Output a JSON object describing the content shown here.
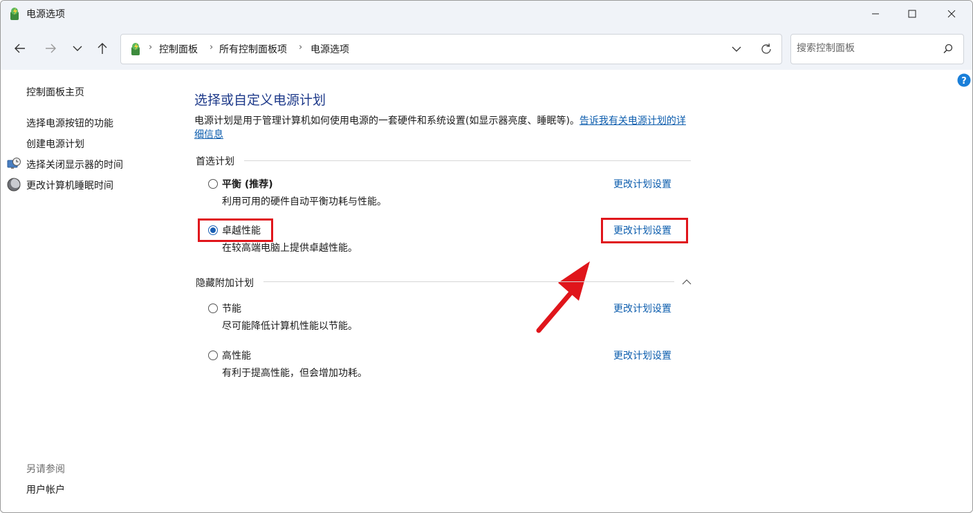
{
  "window": {
    "title": "电源选项"
  },
  "nav": {
    "breadcrumbs": [
      "控制面板",
      "所有控制面板项",
      "电源选项"
    ],
    "search_placeholder": "搜索控制面板"
  },
  "sidebar": {
    "home": "控制面板主页",
    "items": [
      {
        "label": "选择电源按钮的功能",
        "icon": ""
      },
      {
        "label": "创建电源计划",
        "icon": ""
      },
      {
        "label": "选择关闭显示器的时间",
        "icon": "monitor-clock-icon"
      },
      {
        "label": "更改计算机睡眠时间",
        "icon": "moon-icon"
      }
    ],
    "see_also_title": "另请参阅",
    "see_also_items": [
      "用户帐户"
    ]
  },
  "main": {
    "heading": "选择或自定义电源计划",
    "description": "电源计划是用于管理计算机如何使用电源的一套硬件和系统设置(如显示器亮度、睡眠等)。",
    "description_link": "告诉我有关电源计划的详细信息",
    "preferred_label": "首选计划",
    "hidden_label": "隐藏附加计划",
    "change_link": "更改计划设置",
    "preferred_plans": [
      {
        "name": "平衡 (推荐)",
        "desc": "利用可用的硬件自动平衡功耗与性能。",
        "selected": false
      },
      {
        "name": "卓越性能",
        "desc": "在较高端电脑上提供卓越性能。",
        "selected": true
      }
    ],
    "hidden_plans": [
      {
        "name": "节能",
        "desc": "尽可能降低计算机性能以节能。",
        "selected": false
      },
      {
        "name": "高性能",
        "desc": "有利于提高性能，但会增加功耗。",
        "selected": false
      }
    ]
  },
  "colors": {
    "accent": "#1a5fb4",
    "link": "#0b5cad",
    "highlight": "#e0151b",
    "heading": "#1e3a8a"
  }
}
